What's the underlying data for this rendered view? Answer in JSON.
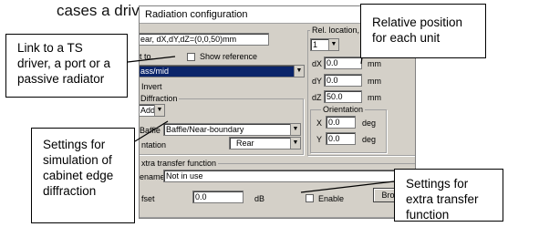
{
  "background_text": "cases a driver",
  "dialog": {
    "title": "Radiation configuration",
    "position_field": "ear, dX,dY,dZ=(0,0,50)mm",
    "connect_label": "t to...",
    "show_reference": "Show reference",
    "driver_value": "ass/mid",
    "invert_label": "Invert",
    "diffraction": {
      "group_label": "Diffraction",
      "add_label": "Add",
      "baffle_label": "Baffle",
      "baffle_value": "Baffle/Near-boundary",
      "orientation_label": "ntation",
      "orientation_value": "Rear"
    },
    "rel_location": {
      "group_label": "Rel. location, orienta",
      "unit_value": "1",
      "dx_label": "dX",
      "dx_value": "0.0",
      "dx_unit": "mm",
      "dy_label": "dY",
      "dy_value": "0.0",
      "dy_unit": "mm",
      "dz_label": "dZ",
      "dz_value": "50.0",
      "dz_unit": "mm"
    },
    "orientation": {
      "group_label": "Orientation",
      "x_label": "X",
      "x_value": "0.0",
      "x_unit": "deg",
      "y_label": "Y",
      "y_value": "0.0",
      "y_unit": "deg"
    },
    "extra_transfer": {
      "group_label": "xtra transfer function",
      "filename_label": "ename",
      "filename_value": "Not in use",
      "offset_label": "fset",
      "offset_value": "0.0",
      "offset_unit": "dB",
      "enable_label": "Enable",
      "browse_label": "Brows"
    }
  },
  "callouts": {
    "relative_position": "Relative position for each unit",
    "link": "Link to a TS driver, a port or a passive radiator",
    "diffraction": "Settings for simulation of cabinet edge diffraction",
    "extra_transfer": "Settings for extra transfer function"
  }
}
